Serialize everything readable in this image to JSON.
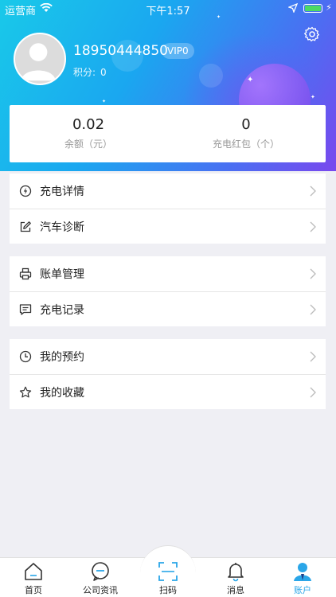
{
  "status_bar": {
    "carrier": "运营商",
    "time": "下午1:57"
  },
  "profile": {
    "phone": "18950444850",
    "vip": "VIP0",
    "points_label": "积分:",
    "points_value": "0"
  },
  "stats": [
    {
      "value": "0.02",
      "label": "余额（元）"
    },
    {
      "value": "0",
      "label": "充电红包（个）"
    }
  ],
  "menu_groups": [
    [
      {
        "label": "充电详情",
        "icon": "lightning-circle-icon"
      },
      {
        "label": "汽车诊断",
        "icon": "edit-icon"
      }
    ],
    [
      {
        "label": "账单管理",
        "icon": "printer-icon"
      },
      {
        "label": "充电记录",
        "icon": "message-icon"
      }
    ],
    [
      {
        "label": "我的预约",
        "icon": "clock-icon"
      },
      {
        "label": "我的收藏",
        "icon": "star-icon"
      }
    ]
  ],
  "tabs": [
    {
      "label": "首页",
      "icon": "home-icon"
    },
    {
      "label": "公司资讯",
      "icon": "chat-icon"
    },
    {
      "label": "扫码",
      "icon": "scan-icon"
    },
    {
      "label": "消息",
      "icon": "bell-icon"
    },
    {
      "label": "账户",
      "icon": "user-icon"
    }
  ],
  "colors": {
    "accent": "#2aa6e8",
    "header_start": "#19c9e9",
    "header_end": "#7a48ee",
    "battery": "#4cd964"
  }
}
